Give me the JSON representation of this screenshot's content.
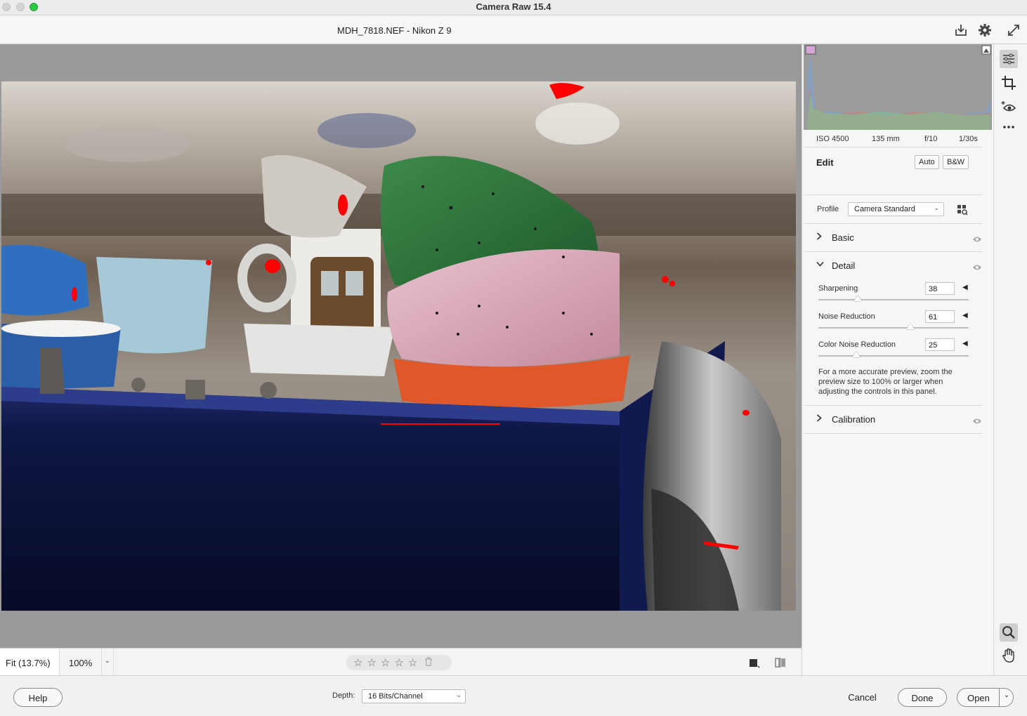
{
  "window": {
    "title": "Camera Raw 15.4"
  },
  "header": {
    "file_title": "MDH_7818.NEF  -  Nikon Z 9",
    "icons": [
      "save-icon",
      "gear-icon",
      "fullscreen-icon"
    ]
  },
  "preview_bar": {
    "zoom_fit": "Fit (13.7%)",
    "zoom_100": "100%",
    "rating_stars": 0,
    "icons": [
      "chevron-down-icon",
      "star-icon",
      "trash-icon",
      "view-mode-icon",
      "before-after-icon"
    ]
  },
  "histogram": {
    "clip_warnings": [
      "shadow-clipping-icon",
      "highlight-clipping-icon"
    ]
  },
  "exif": {
    "iso": "ISO 4500",
    "focal": "135 mm",
    "aperture": "f/10",
    "shutter": "1/30s"
  },
  "edit": {
    "title": "Edit",
    "auto_label": "Auto",
    "bw_label": "B&W",
    "profile_label": "Profile",
    "profile_value": "Camera Standard",
    "sections": {
      "basic": {
        "label": "Basic",
        "expanded": false
      },
      "detail": {
        "label": "Detail",
        "expanded": true
      },
      "calibration": {
        "label": "Calibration",
        "expanded": false
      }
    },
    "sliders": [
      {
        "label": "Sharpening",
        "value": "38",
        "fraction": 0.26
      },
      {
        "label": "Noise Reduction",
        "value": "61",
        "fraction": 0.61
      },
      {
        "label": "Color Noise Reduction",
        "value": "25",
        "fraction": 0.25
      }
    ],
    "note": "For a more accurate preview, zoom the preview size to 100% or larger when adjusting the controls in this panel."
  },
  "tools": [
    "edit-icon",
    "crop-icon",
    "red-eye-icon",
    "more-icon",
    "zoom-icon",
    "hand-icon"
  ],
  "footer": {
    "help_label": "Help",
    "depth_label": "Depth:",
    "depth_value": "16 Bits/Channel",
    "cancel_label": "Cancel",
    "done_label": "Done",
    "open_label": "Open"
  }
}
